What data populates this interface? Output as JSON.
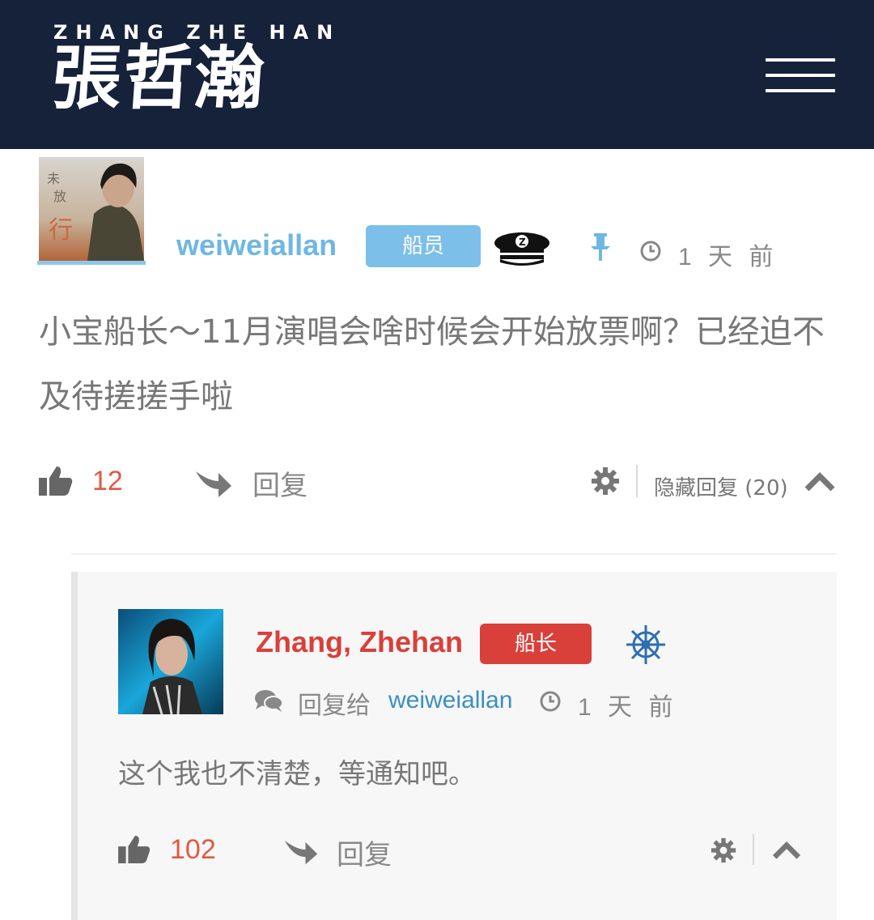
{
  "header": {
    "logo_en": "ZHANG ZHE HAN",
    "logo_cn": "張哲瀚",
    "menu_icon": "hamburger-menu-icon",
    "bg_color": "#16213a"
  },
  "comment": {
    "username": "weiweiallan",
    "role_badge": "船员",
    "role_icon": "captain-hat-icon",
    "pinned_icon": "pin-icon",
    "time": "1 天 前",
    "text": "小宝船长～11月演唱会啥时候会开始放票啊？已经迫不及待搓搓手啦",
    "likes": "12",
    "reply_label": "回复",
    "hide_replies": "隐藏回复 (20)",
    "colors": {
      "username": "#6fb7e3",
      "badge": "#7cbfe9",
      "likes": "#e05a43"
    }
  },
  "reply": {
    "author": "Zhang, Zhehan",
    "role_badge": "船长",
    "role_icon": "ship-wheel-icon",
    "reply_to_label": "回复给",
    "reply_to_user": "weiweiallan",
    "time": "1 天 前",
    "text": "这个我也不清楚，等通知吧。",
    "likes": "102",
    "reply_label": "回复",
    "colors": {
      "author": "#d9403a",
      "badge": "#d9403a",
      "reply_to_user": "#3a8fc4"
    }
  }
}
